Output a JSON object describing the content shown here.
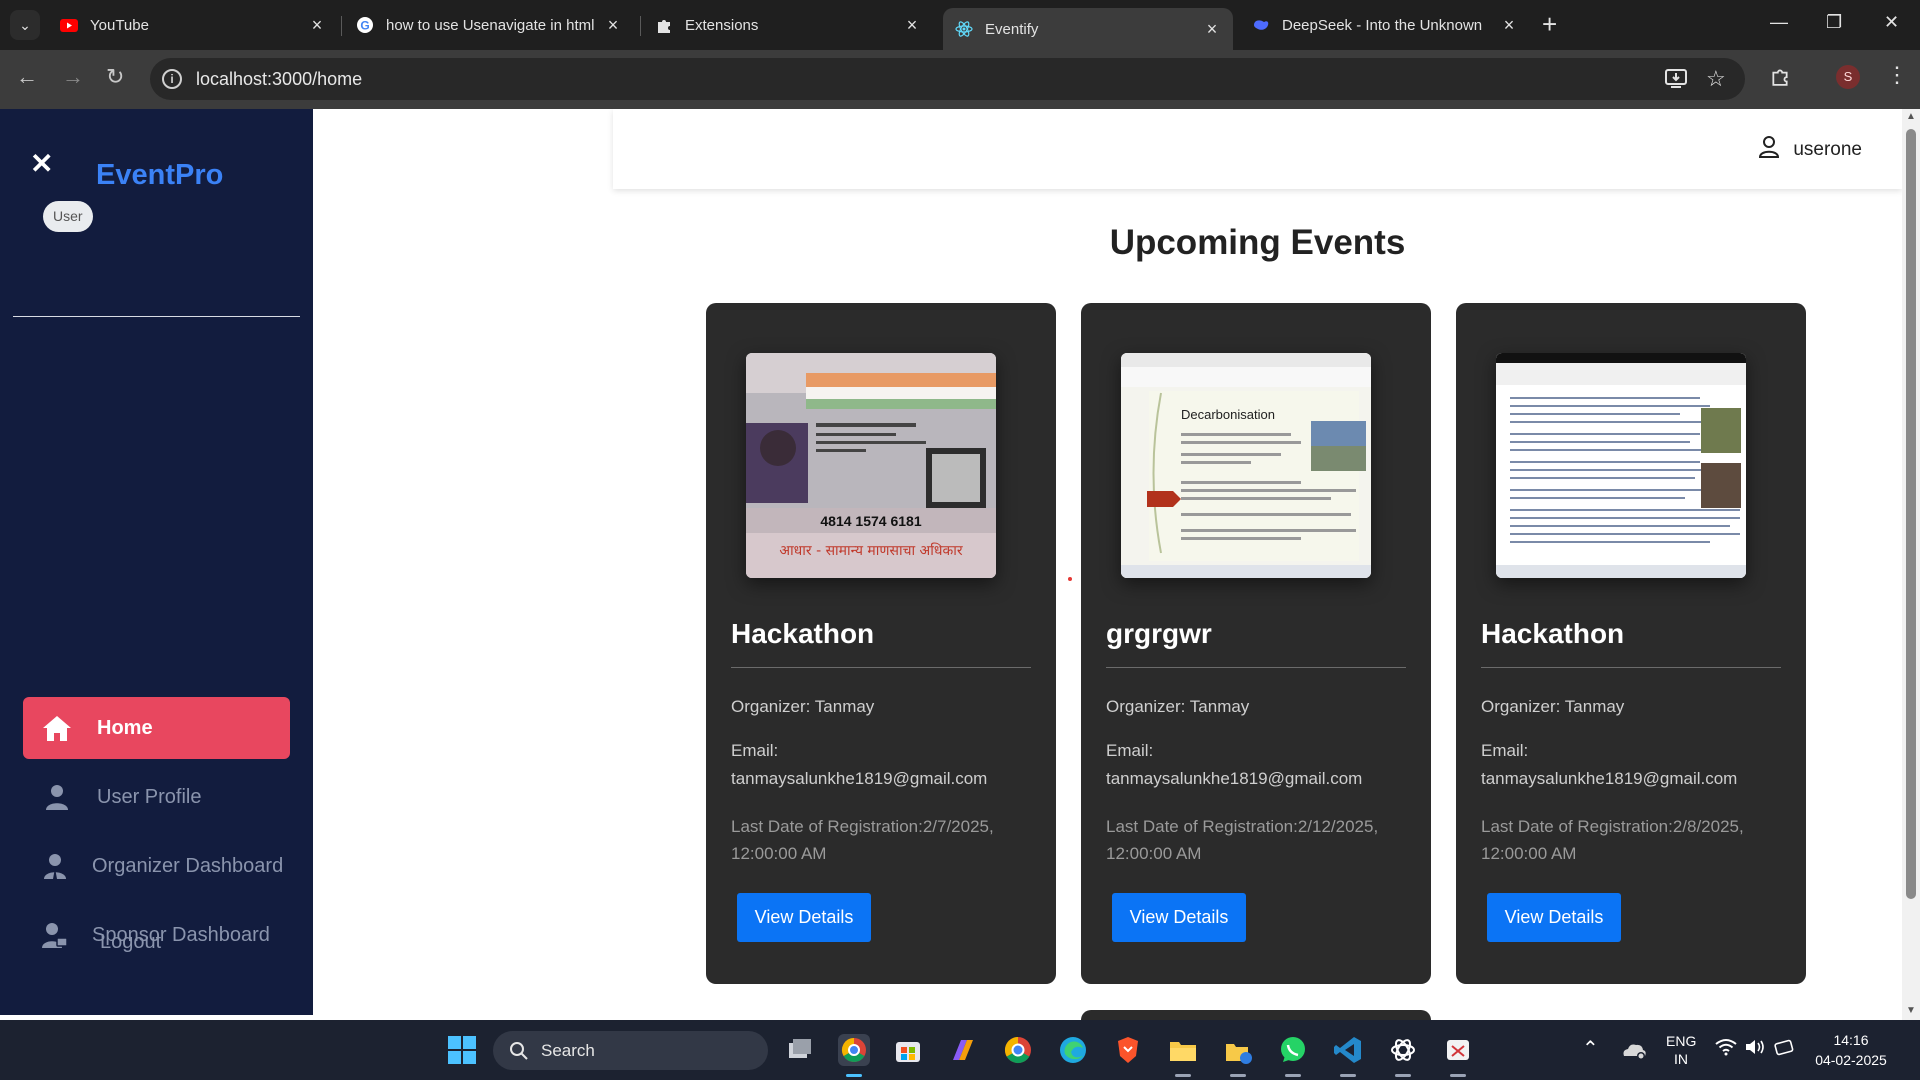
{
  "browser": {
    "tabs": [
      {
        "title": "YouTube",
        "icon": "youtube-icon"
      },
      {
        "title": "how to use Usenavigate in html",
        "icon": "google-icon"
      },
      {
        "title": "Extensions",
        "icon": "puzzle-icon"
      },
      {
        "title": "Eventify",
        "icon": "react-icon",
        "active": true
      },
      {
        "title": "DeepSeek - Into the Unknown",
        "icon": "deepseek-icon"
      }
    ],
    "url": "localhost:3000/home",
    "profile_initial": "S"
  },
  "sidebar": {
    "brand": "EventPro",
    "role": "User",
    "items": [
      {
        "label": "Home",
        "icon": "home-icon",
        "active": true
      },
      {
        "label": "User Profile",
        "icon": "user-icon"
      },
      {
        "label": "Organizer Dashboard",
        "icon": "organizer-icon"
      },
      {
        "label": "Sponsor Dashboard",
        "icon": "sponsor-icon"
      }
    ],
    "logout": "Logout"
  },
  "header": {
    "username": "userone"
  },
  "main": {
    "title": "Upcoming Events",
    "events": [
      {
        "name": "Hackathon",
        "organizer": "Organizer: Tanmay",
        "email_label": "Email:",
        "email": "tanmaysalunkhe1819@gmail.com",
        "deadline": "Last Date of Registration:2/7/2025, 12:00:00 AM",
        "button": "View Details",
        "image": "id-card-photo",
        "image_text": "4814 1574 6181",
        "image_caption": "आधार - सामान्य माणसाचा अधिकार"
      },
      {
        "name": "grgrgwr",
        "organizer": "Organizer: Tanmay",
        "email_label": "Email:",
        "email": "tanmaysalunkhe1819@gmail.com",
        "deadline": "Last Date of Registration:2/12/2025, 12:00:00 AM",
        "button": "View Details",
        "image": "slide-screenshot",
        "image_text": "Decarbonisation"
      },
      {
        "name": "Hackathon",
        "organizer": "Organizer: Tanmay",
        "email_label": "Email:",
        "email": "tanmaysalunkhe1819@gmail.com",
        "deadline": "Last Date of Registration:2/8/2025, 12:00:00 AM",
        "button": "View Details",
        "image": "document-screenshot"
      }
    ]
  },
  "taskbar": {
    "search_placeholder": "Search",
    "lang": "ENG",
    "region": "IN",
    "time": "14:16",
    "date": "04-02-2025"
  }
}
